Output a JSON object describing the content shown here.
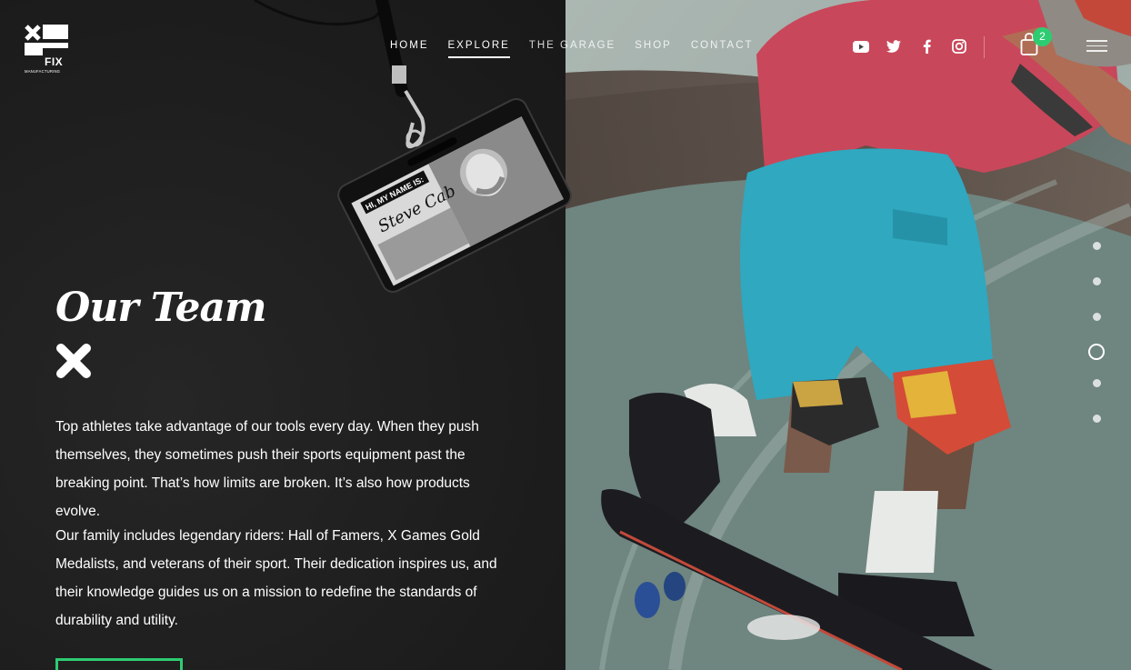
{
  "brand": {
    "logo_text": "FIX",
    "logo_subtext": "MANUFACTURING"
  },
  "nav": {
    "items": [
      {
        "label": "HOME"
      },
      {
        "label": "EXPLORE"
      },
      {
        "label": "THE GARAGE"
      },
      {
        "label": "SHOP"
      },
      {
        "label": "CONTACT"
      }
    ],
    "active": "EXPLORE"
  },
  "social": [
    "youtube-icon",
    "twitter-icon",
    "facebook-icon",
    "instagram-icon"
  ],
  "cart": {
    "count": "2"
  },
  "badge_card": {
    "header": "HI, MY NAME IS:",
    "name": "Steve Cab"
  },
  "section": {
    "title": "Our Team",
    "paragraph_1": "Top athletes take advantage of our tools every day. When they push themselves, they sometimes push their sports equipment past the breaking point. That’s how limits are broken. It’s also how products evolve.",
    "paragraph_2": "Our family includes legendary riders: Hall of Famers, X Games Gold Medalists, and veterans of their sport. Their dedication inspires us, and their knowledge guides us on a mission to redefine the standards of durability and utility."
  },
  "pager": {
    "total": 6,
    "active_index": 4
  },
  "colors": {
    "accent": "#2ecc71",
    "background": "#1f1f1f",
    "text": "#ffffff"
  }
}
